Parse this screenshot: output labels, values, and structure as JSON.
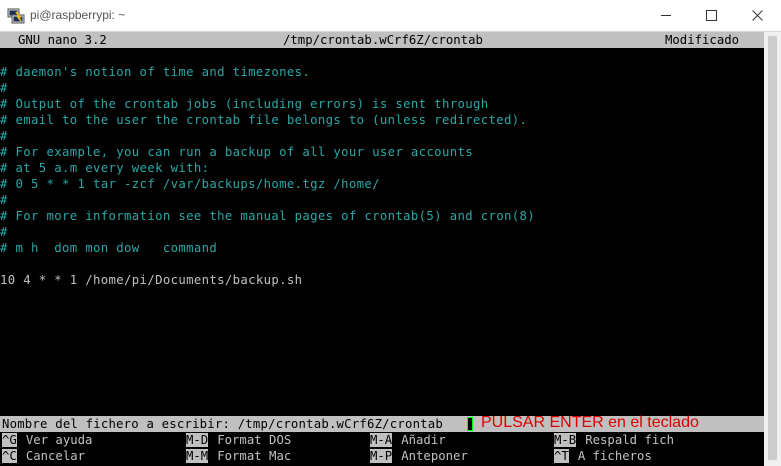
{
  "window": {
    "title": "pi@raspberrypi: ~"
  },
  "nano": {
    "version": "GNU nano 3.2",
    "file": "/tmp/crontab.wCrf6Z/crontab",
    "status": "Modificado"
  },
  "lines": [
    {
      "text": "# daemon's notion of time and timezones.",
      "type": "comment"
    },
    {
      "text": "#",
      "type": "comment"
    },
    {
      "text": "# Output of the crontab jobs (including errors) is sent through",
      "type": "comment"
    },
    {
      "text": "# email to the user the crontab file belongs to (unless redirected).",
      "type": "comment"
    },
    {
      "text": "#",
      "type": "comment"
    },
    {
      "text": "# For example, you can run a backup of all your user accounts",
      "type": "comment"
    },
    {
      "text": "# at 5 a.m every week with:",
      "type": "comment"
    },
    {
      "text": "# 0 5 * * 1 tar -zcf /var/backups/home.tgz /home/",
      "type": "comment"
    },
    {
      "text": "#",
      "type": "comment"
    },
    {
      "text": "# For more information see the manual pages of crontab(5) and cron(8)",
      "type": "comment"
    },
    {
      "text": "#",
      "type": "comment"
    },
    {
      "text": "# m h  dom mon dow   command",
      "type": "comment"
    },
    {
      "text": "",
      "type": "plain"
    },
    {
      "text": "10 4 * * 1 /home/pi/Documents/backup.sh",
      "type": "plain"
    }
  ],
  "prompt": {
    "text": "Nombre del fichero a escribir: /tmp/crontab.wCrf6Z/crontab",
    "annotation": "PULSAR ENTER en el teclado"
  },
  "help_rows": [
    [
      {
        "key": "^G",
        "label": "Ver ayuda"
      },
      {
        "key": "M-D",
        "label": "Format DOS"
      },
      {
        "key": "M-A",
        "label": "Añadir"
      },
      {
        "key": "M-B",
        "label": "Respald fich"
      }
    ],
    [
      {
        "key": "^C",
        "label": "Cancelar"
      },
      {
        "key": "M-M",
        "label": "Format Mac"
      },
      {
        "key": "M-P",
        "label": "Anteponer"
      },
      {
        "key": "^T",
        "label": "A ficheros"
      }
    ]
  ],
  "colors": {
    "comment": "#2aa6a6",
    "text": "#c0c0c0",
    "bar_bg": "#c0c0c0",
    "annotation": "#e00000",
    "cursor_border": "#00ff00"
  }
}
